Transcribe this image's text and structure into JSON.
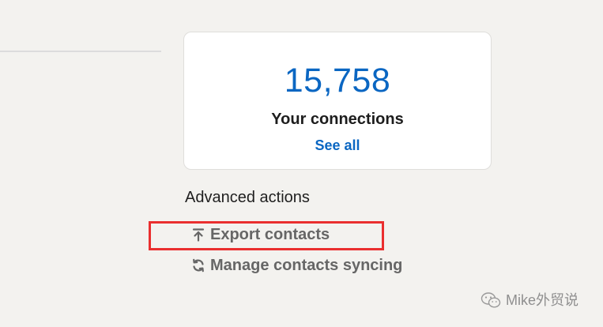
{
  "connections": {
    "count": "15,758",
    "label": "Your connections",
    "see_all_label": "See all"
  },
  "advanced_actions": {
    "heading": "Advanced actions",
    "items": [
      {
        "label": "Export contacts",
        "icon": "export-upload-icon"
      },
      {
        "label": "Manage contacts syncing",
        "icon": "sync-icon"
      }
    ]
  },
  "highlight": {
    "color": "#ea2f2f"
  },
  "watermark": {
    "text": "Mike外贸说",
    "icon": "wechat-icon"
  },
  "colors": {
    "accent": "#0a66c2",
    "background": "#f3f2ef",
    "action_text": "#666666"
  }
}
